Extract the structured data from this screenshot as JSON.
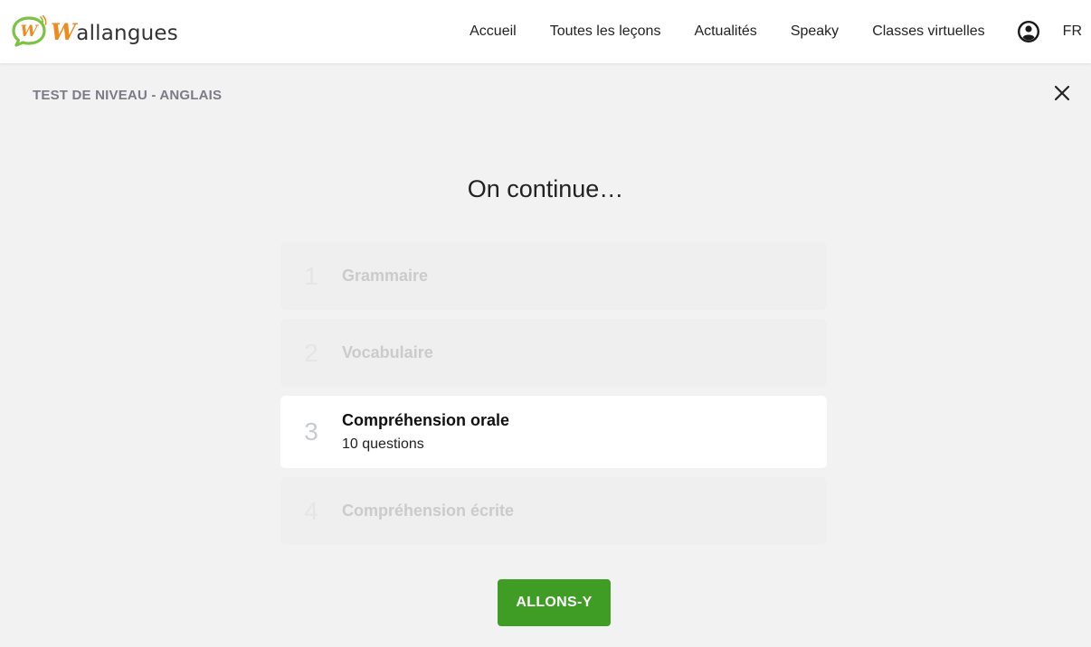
{
  "brand": {
    "logo_letter": "W",
    "logo_rest": "allangues",
    "accent": "#f08a1e",
    "bubble_color": "#7cc243"
  },
  "nav": {
    "items": [
      "Accueil",
      "Toutes les leçons",
      "Actualités",
      "Speaky",
      "Classes virtuelles"
    ],
    "user_icon": "user-circle-icon",
    "language": "FR"
  },
  "test": {
    "title": "TEST DE NIVEAU - ANGLAIS",
    "close_icon": "close-icon"
  },
  "main": {
    "heading": "On continue…",
    "steps": [
      {
        "number": "1",
        "label": "Grammaire",
        "sub": ""
      },
      {
        "number": "2",
        "label": "Vocabulaire",
        "sub": ""
      },
      {
        "number": "3",
        "label": "Compréhension orale",
        "sub": "10 questions"
      },
      {
        "number": "4",
        "label": "Compréhension écrite",
        "sub": ""
      }
    ],
    "active_step": 3,
    "cta_label": "ALLONS-Y",
    "cta_color": "#3f9c25"
  }
}
